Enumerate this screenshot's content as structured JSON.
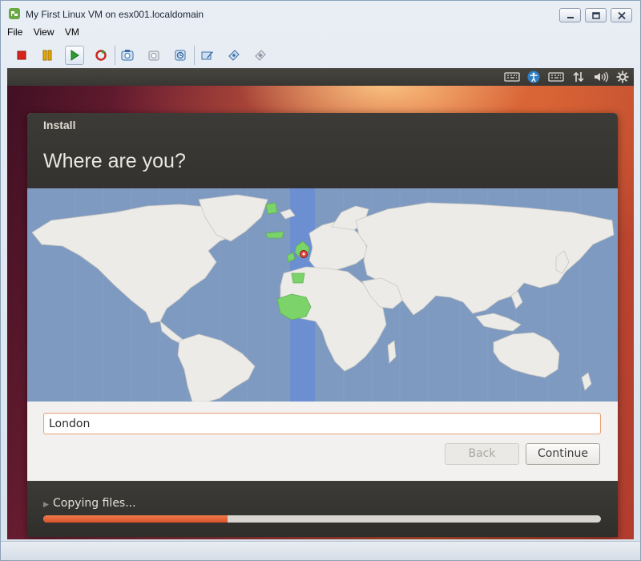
{
  "window": {
    "title": "My First Linux VM on esx001.localdomain"
  },
  "menu": [
    "File",
    "View",
    "VM"
  ],
  "toolbar": {
    "buttons": [
      {
        "name": "power-off",
        "icon": "stop-square-icon",
        "color": "#d8231b"
      },
      {
        "name": "suspend",
        "icon": "pause-icon",
        "color": "#e9a800"
      },
      {
        "name": "power-on",
        "icon": "play-icon",
        "color": "#2e9d2e",
        "active": true
      },
      {
        "name": "reset",
        "icon": "reset-icon",
        "color": "#c8261e"
      },
      {
        "name": "snapshot",
        "icon": "snapshot-icon"
      },
      {
        "name": "revert-snapshot",
        "icon": "revert-snapshot-icon"
      },
      {
        "name": "snapshot-manager",
        "icon": "snapshot-manager-icon"
      },
      {
        "name": "edit-settings",
        "icon": "edit-settings-icon"
      },
      {
        "name": "connect-cd",
        "icon": "cd-icon"
      },
      {
        "name": "connect-floppy",
        "icon": "floppy-icon"
      }
    ]
  },
  "guest_panel": {
    "indicators": [
      "keyboard-icon",
      "accessibility-icon",
      "keyboard-layout-icon",
      "network-icon",
      "volume-icon",
      "settings-gear-icon"
    ]
  },
  "installer": {
    "window_title": "Install",
    "heading": "Where are you?",
    "location_value": "London",
    "back_label": "Back",
    "continue_label": "Continue",
    "status_text": "Copying files...",
    "progress_fraction": 0.33,
    "selected_timezone_color": "#7bd36a",
    "selected_band_color": "#6b8fd0",
    "accent_color": "#e05a2b"
  }
}
